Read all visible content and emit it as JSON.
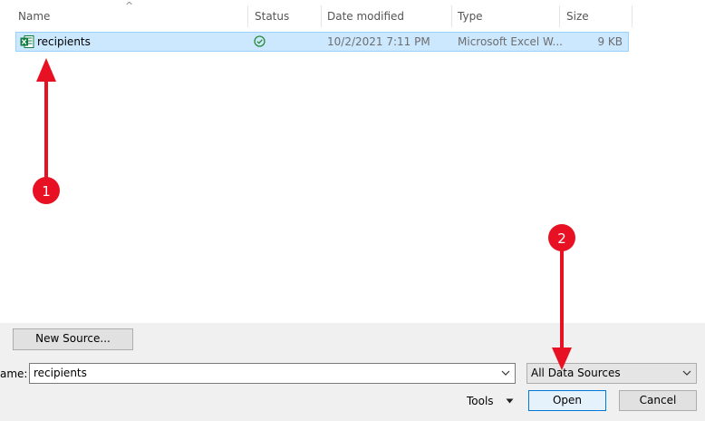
{
  "columns": [
    {
      "key": "name",
      "label": "Name"
    },
    {
      "key": "status",
      "label": "Status"
    },
    {
      "key": "date",
      "label": "Date modified"
    },
    {
      "key": "type",
      "label": "Type"
    },
    {
      "key": "size",
      "label": "Size"
    }
  ],
  "files": [
    {
      "name": "recipients",
      "status_icon": "synced-check-icon",
      "date": "10/2/2021 7:11 PM",
      "type": "Microsoft Excel W...",
      "size": "9 KB",
      "icon": "excel-file-icon"
    }
  ],
  "buttons": {
    "new_source": "New Source...",
    "tools": "Tools",
    "open": "Open",
    "cancel": "Cancel"
  },
  "filename": {
    "label": "ame:",
    "value": "recipients"
  },
  "filetype": {
    "value": "All Data Sources"
  },
  "annotations": [
    {
      "number": "1",
      "color": "#e81123"
    },
    {
      "number": "2",
      "color": "#e81123"
    }
  ],
  "colors": {
    "selection": "#cce8ff",
    "selection_border": "#99d1ff",
    "excel_green": "#107c41",
    "annotation_red": "#e81123",
    "dialog_bg": "#f0f0f0"
  }
}
